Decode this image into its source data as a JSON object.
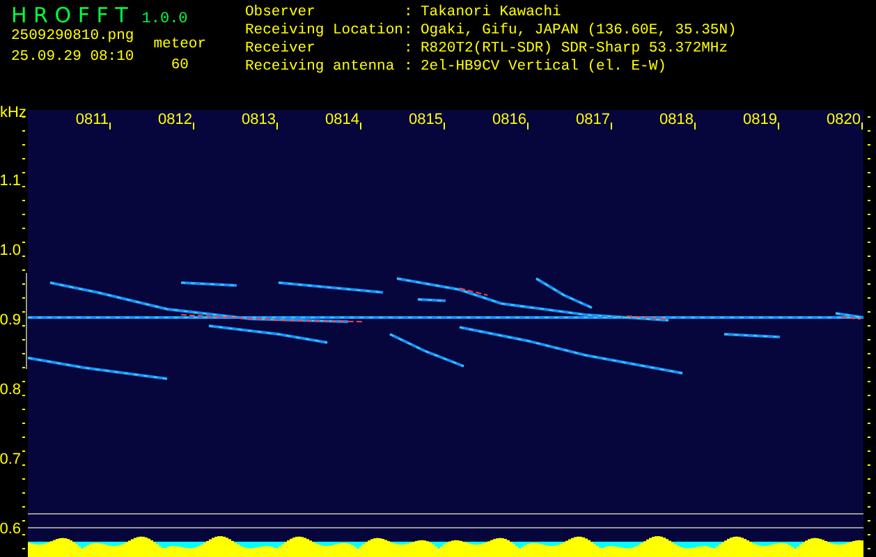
{
  "header": {
    "title": "H R O F F T",
    "version": "1.0.0",
    "filename": "2509290810.png",
    "datetime": "25.09.29 08:10",
    "meteor_label": "meteor",
    "meteor_count": "60"
  },
  "info": [
    {
      "label": "Observer",
      "separator": ":",
      "value": "Takanori Kawachi"
    },
    {
      "label": "Receiving Location",
      "separator": ":",
      "value": "Ogaki, Gifu, JAPAN (136.60E, 35.35N)"
    },
    {
      "label": "Receiver",
      "separator": ":",
      "value": "R820T2(RTL-SDR) SDR-Sharp 53.372MHz"
    },
    {
      "label": "Receiving antenna",
      "separator": ":",
      "value": "2el-HB9CV Vertical (el. E-W)"
    }
  ],
  "spectrogram": {
    "unit": "kHz",
    "time_labels": [
      "0811",
      "0812",
      "0813",
      "0814",
      "0815",
      "0816",
      "0817",
      "0818",
      "0819",
      "0820"
    ],
    "freq_labels": [
      "1.1",
      "1.0",
      "0.9",
      "0.8",
      "0.7",
      "0.6"
    ]
  }
}
